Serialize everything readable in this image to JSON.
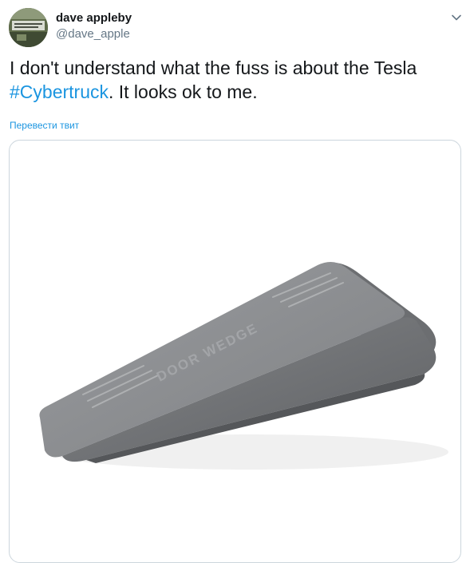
{
  "user": {
    "name": "dave appleby",
    "handle": "@dave_apple",
    "avatar_icon": "avatar-photo-icon"
  },
  "menu": {
    "icon": "chevron-down-icon"
  },
  "tweet": {
    "text_before": "I don't understand what the fuss is about the Tesla ",
    "hashtag": "#Cybertruck",
    "text_after": ". It looks ok to me."
  },
  "translate": {
    "label": "Перевести твит"
  },
  "media": {
    "wedge_text": "DOOR WEDGE",
    "colors": {
      "wedge_top": "#8a8c8f",
      "wedge_side": "#6c6e71",
      "wedge_front": "#b3b5b7"
    }
  },
  "colors": {
    "link": "#1b95e0",
    "secondary_text": "#657786",
    "border": "#ccd6dd"
  }
}
